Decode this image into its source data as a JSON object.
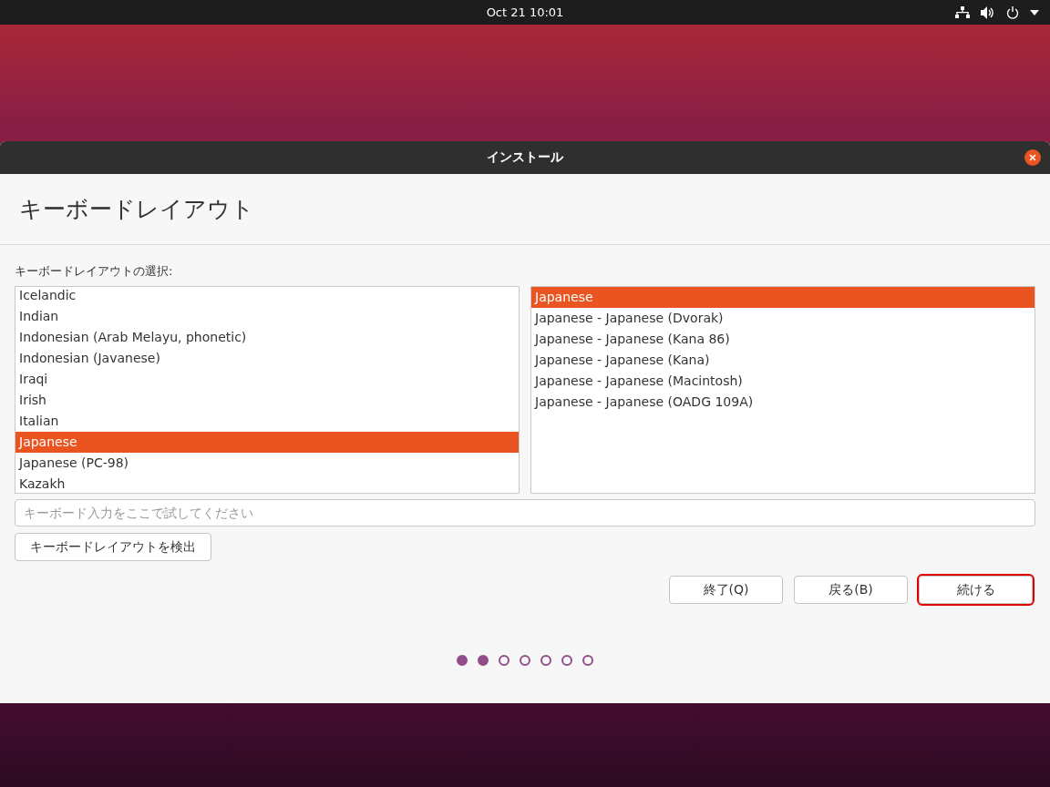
{
  "top_bar": {
    "clock": "Oct 21  10:01"
  },
  "window": {
    "title": "インストール"
  },
  "heading": "キーボードレイアウト",
  "layout_label": "キーボードレイアウトの選択:",
  "layouts": [
    {
      "label": "Icelandic",
      "selected": false
    },
    {
      "label": "Indian",
      "selected": false
    },
    {
      "label": "Indonesian (Arab Melayu, phonetic)",
      "selected": false
    },
    {
      "label": "Indonesian (Javanese)",
      "selected": false
    },
    {
      "label": "Iraqi",
      "selected": false
    },
    {
      "label": "Irish",
      "selected": false
    },
    {
      "label": "Italian",
      "selected": false
    },
    {
      "label": "Japanese",
      "selected": true
    },
    {
      "label": "Japanese (PC-98)",
      "selected": false
    },
    {
      "label": "Kazakh",
      "selected": false
    }
  ],
  "variants": [
    {
      "label": "Japanese",
      "selected": true
    },
    {
      "label": "Japanese - Japanese (Dvorak)",
      "selected": false
    },
    {
      "label": "Japanese - Japanese (Kana 86)",
      "selected": false
    },
    {
      "label": "Japanese - Japanese (Kana)",
      "selected": false
    },
    {
      "label": "Japanese - Japanese (Macintosh)",
      "selected": false
    },
    {
      "label": "Japanese - Japanese (OADG 109A)",
      "selected": false
    }
  ],
  "test_field": {
    "placeholder": "キーボード入力をここで試してください"
  },
  "detect_button": "キーボードレイアウトを検出",
  "buttons": [
    {
      "label": "終了(Q)",
      "highlighted": false
    },
    {
      "label": "戻る(B)",
      "highlighted": false
    },
    {
      "label": "続ける",
      "highlighted": true
    }
  ],
  "steps": [
    {
      "selected": true
    },
    {
      "selected": true
    },
    {
      "selected": false
    },
    {
      "selected": false
    },
    {
      "selected": false
    },
    {
      "selected": false
    },
    {
      "selected": false
    }
  ]
}
